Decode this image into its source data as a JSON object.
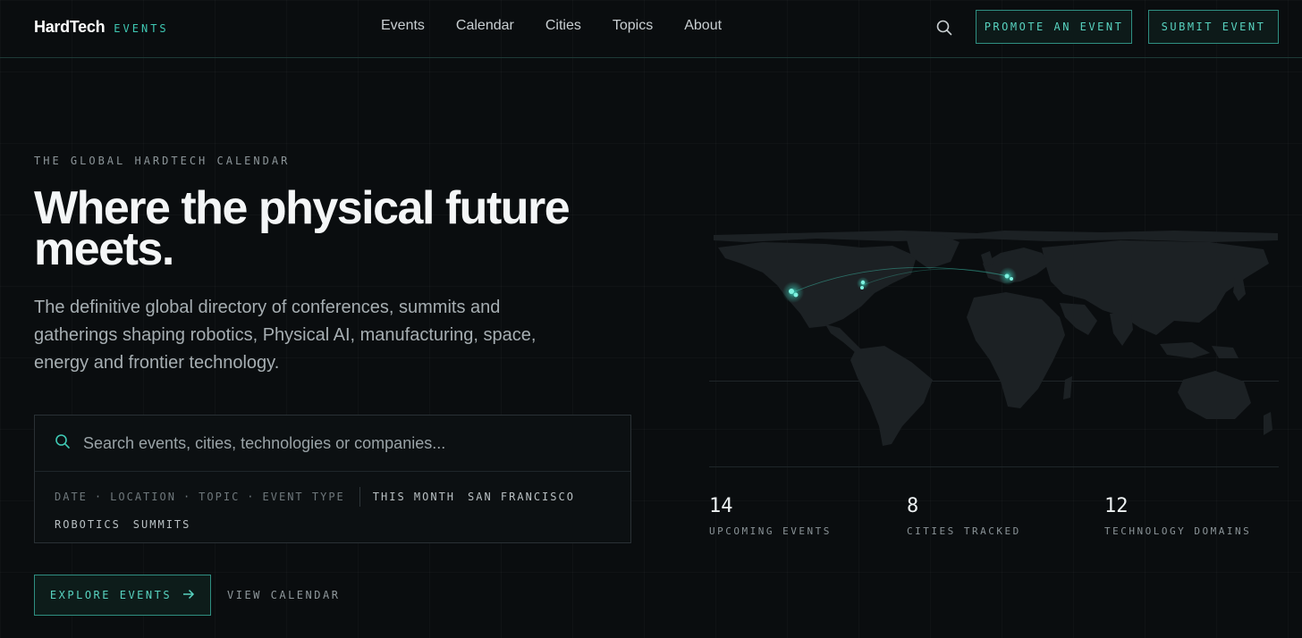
{
  "brand": {
    "name": "HardTech",
    "tag": "EVENTS"
  },
  "nav": {
    "links": [
      "Events",
      "Calendar",
      "Cities",
      "Topics",
      "About"
    ],
    "search_icon": "search-icon",
    "promote_label": "PROMOTE AN EVENT",
    "submit_label": "SUBMIT EVENT"
  },
  "hero": {
    "eyebrow": "THE GLOBAL HARDTECH CALENDAR",
    "headline_line1": "Where the physical future",
    "headline_line2": "meets.",
    "subtext": "The definitive global directory of conferences, summits and gatherings shaping robotics, Physical AI, manufacturing, space, energy and frontier technology."
  },
  "search": {
    "placeholder": "Search events, cities, technologies or companies...",
    "filters": [
      "DATE",
      "LOCATION",
      "TOPIC",
      "EVENT TYPE"
    ],
    "separator": "·",
    "chips": [
      "THIS MONTH",
      "SAN FRANCISCO",
      "ROBOTICS",
      "SUMMITS"
    ]
  },
  "cta": {
    "primary_label": "EXPLORE EVENTS",
    "primary_icon": "arrow-right-icon",
    "secondary_label": "VIEW CALENDAR"
  },
  "stats": [
    {
      "value": "14",
      "label": "UPCOMING EVENTS"
    },
    {
      "value": "8",
      "label": "CITIES TRACKED"
    },
    {
      "value": "12",
      "label": "TECHNOLOGY DOMAINS"
    }
  ],
  "colors": {
    "background": "#0a0d0f",
    "accent": "#3fc9b4",
    "map_land": "#1c2124",
    "map_marker": "#3fe0c8"
  }
}
